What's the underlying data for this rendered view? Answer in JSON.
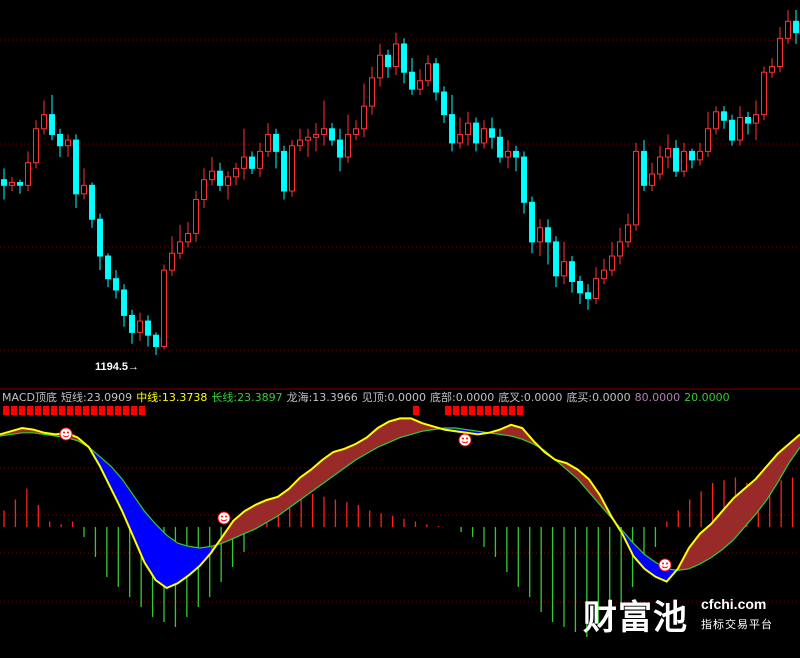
{
  "price_label": {
    "low_text": "1194.5→"
  },
  "indicator_header": {
    "title": "MACD顶底",
    "items": [
      {
        "label": "短线:23.0909",
        "color": "#c0c0c0"
      },
      {
        "label": "中线:13.3738",
        "color": "#ffff00"
      },
      {
        "label": "长线:23.3897",
        "color": "#33cc33"
      },
      {
        "label": "龙海:13.3966",
        "color": "#c0c0c0"
      },
      {
        "label": "见顶:0.0000",
        "color": "#c0c0c0"
      },
      {
        "label": "底部:0.0000",
        "color": "#c0c0c0"
      },
      {
        "label": "底叉:0.0000",
        "color": "#c0c0c0"
      },
      {
        "label": "底买:0.0000",
        "color": "#c0c0c0"
      },
      {
        "label": "80.0000",
        "color": "#b080b0"
      },
      {
        "label": "20.0000",
        "color": "#33cc33"
      }
    ]
  },
  "watermark": {
    "brand_cn": "财富池",
    "url": "cfchi.com",
    "tagline": "指标交易平台"
  },
  "colors": {
    "up": "#ff3333",
    "down": "#00ffff",
    "grid": "#800000",
    "fast_line": "#ffff00",
    "slow_line": "#33cc33",
    "bear_fill": "#0000ff",
    "bull_fill": "#992a2a",
    "signal_red": "#ff0000"
  },
  "chart_data": {
    "type": "candlestick",
    "low_annotation": 1194.5,
    "candles": [
      [
        0,
        0.62,
        0.6,
        0.55,
        0.66
      ],
      [
        1,
        0.6,
        0.61,
        0.58,
        0.63
      ],
      [
        2,
        0.61,
        0.6,
        0.57,
        0.62
      ],
      [
        3,
        0.6,
        0.68,
        0.58,
        0.72
      ],
      [
        4,
        0.68,
        0.8,
        0.66,
        0.83
      ],
      [
        5,
        0.8,
        0.85,
        0.78,
        0.9
      ],
      [
        6,
        0.85,
        0.78,
        0.76,
        0.92
      ],
      [
        7,
        0.78,
        0.74,
        0.7,
        0.8
      ],
      [
        8,
        0.74,
        0.76,
        0.7,
        0.78
      ],
      [
        9,
        0.76,
        0.57,
        0.52,
        0.78
      ],
      [
        10,
        0.57,
        0.6,
        0.55,
        0.66
      ],
      [
        11,
        0.6,
        0.48,
        0.45,
        0.61
      ],
      [
        12,
        0.48,
        0.35,
        0.3,
        0.5
      ],
      [
        13,
        0.35,
        0.27,
        0.24,
        0.36
      ],
      [
        14,
        0.27,
        0.23,
        0.2,
        0.3
      ],
      [
        15,
        0.23,
        0.14,
        0.1,
        0.25
      ],
      [
        16,
        0.14,
        0.08,
        0.04,
        0.16
      ],
      [
        17,
        0.08,
        0.12,
        0.05,
        0.15
      ],
      [
        18,
        0.12,
        0.07,
        0.03,
        0.14
      ],
      [
        19,
        0.07,
        0.03,
        0.0,
        0.08
      ],
      [
        20,
        0.03,
        0.3,
        0.02,
        0.32
      ],
      [
        21,
        0.3,
        0.36,
        0.28,
        0.42
      ],
      [
        22,
        0.36,
        0.4,
        0.34,
        0.46
      ],
      [
        23,
        0.4,
        0.43,
        0.38,
        0.47
      ],
      [
        24,
        0.43,
        0.55,
        0.4,
        0.58
      ],
      [
        25,
        0.55,
        0.62,
        0.52,
        0.66
      ],
      [
        26,
        0.62,
        0.65,
        0.6,
        0.7
      ],
      [
        27,
        0.65,
        0.6,
        0.58,
        0.68
      ],
      [
        28,
        0.6,
        0.63,
        0.55,
        0.65
      ],
      [
        29,
        0.63,
        0.66,
        0.6,
        0.68
      ],
      [
        30,
        0.66,
        0.7,
        0.62,
        0.8
      ],
      [
        31,
        0.7,
        0.66,
        0.64,
        0.72
      ],
      [
        32,
        0.66,
        0.72,
        0.63,
        0.75
      ],
      [
        33,
        0.72,
        0.78,
        0.7,
        0.82
      ],
      [
        34,
        0.78,
        0.72,
        0.66,
        0.8
      ],
      [
        35,
        0.72,
        0.58,
        0.55,
        0.74
      ],
      [
        36,
        0.58,
        0.74,
        0.56,
        0.76
      ],
      [
        37,
        0.74,
        0.76,
        0.72,
        0.8
      ],
      [
        38,
        0.76,
        0.77,
        0.7,
        0.8
      ],
      [
        39,
        0.77,
        0.78,
        0.72,
        0.82
      ],
      [
        40,
        0.78,
        0.8,
        0.74,
        0.9
      ],
      [
        41,
        0.8,
        0.76,
        0.74,
        0.82
      ],
      [
        42,
        0.76,
        0.7,
        0.65,
        0.8
      ],
      [
        43,
        0.7,
        0.78,
        0.68,
        0.85
      ],
      [
        44,
        0.78,
        0.8,
        0.76,
        0.83
      ],
      [
        45,
        0.8,
        0.88,
        0.77,
        0.96
      ],
      [
        46,
        0.88,
        0.98,
        0.85,
        1.02
      ],
      [
        47,
        0.98,
        1.06,
        0.95,
        1.1
      ],
      [
        48,
        1.06,
        1.02,
        0.98,
        1.08
      ],
      [
        49,
        1.02,
        1.1,
        0.99,
        1.14
      ],
      [
        50,
        1.1,
        1.0,
        0.96,
        1.12
      ],
      [
        51,
        1.0,
        0.94,
        0.92,
        1.05
      ],
      [
        52,
        0.94,
        0.97,
        0.92,
        1.01
      ],
      [
        53,
        0.97,
        1.03,
        0.95,
        1.06
      ],
      [
        54,
        1.03,
        0.93,
        0.9,
        1.05
      ],
      [
        55,
        0.93,
        0.85,
        0.82,
        0.95
      ],
      [
        56,
        0.85,
        0.75,
        0.72,
        0.92
      ],
      [
        57,
        0.75,
        0.78,
        0.73,
        0.84
      ],
      [
        58,
        0.78,
        0.82,
        0.74,
        0.86
      ],
      [
        59,
        0.82,
        0.75,
        0.72,
        0.84
      ],
      [
        60,
        0.75,
        0.8,
        0.73,
        0.83
      ],
      [
        61,
        0.8,
        0.77,
        0.73,
        0.84
      ],
      [
        62,
        0.77,
        0.7,
        0.68,
        0.8
      ],
      [
        63,
        0.7,
        0.72,
        0.66,
        0.76
      ],
      [
        64,
        0.72,
        0.7,
        0.65,
        0.74
      ],
      [
        65,
        0.7,
        0.54,
        0.5,
        0.72
      ],
      [
        66,
        0.54,
        0.4,
        0.36,
        0.56
      ],
      [
        67,
        0.4,
        0.45,
        0.35,
        0.48
      ],
      [
        68,
        0.45,
        0.4,
        0.32,
        0.48
      ],
      [
        69,
        0.4,
        0.28,
        0.24,
        0.42
      ],
      [
        70,
        0.28,
        0.33,
        0.25,
        0.4
      ],
      [
        71,
        0.33,
        0.26,
        0.22,
        0.35
      ],
      [
        72,
        0.26,
        0.22,
        0.18,
        0.28
      ],
      [
        73,
        0.22,
        0.2,
        0.16,
        0.25
      ],
      [
        74,
        0.2,
        0.27,
        0.18,
        0.31
      ],
      [
        75,
        0.27,
        0.3,
        0.25,
        0.34
      ],
      [
        76,
        0.3,
        0.35,
        0.28,
        0.4
      ],
      [
        77,
        0.35,
        0.4,
        0.32,
        0.45
      ],
      [
        78,
        0.4,
        0.46,
        0.38,
        0.5
      ],
      [
        79,
        0.46,
        0.72,
        0.44,
        0.75
      ],
      [
        80,
        0.72,
        0.6,
        0.58,
        0.76
      ],
      [
        81,
        0.6,
        0.64,
        0.58,
        0.68
      ],
      [
        82,
        0.64,
        0.7,
        0.62,
        0.74
      ],
      [
        83,
        0.7,
        0.73,
        0.66,
        0.78
      ],
      [
        84,
        0.73,
        0.65,
        0.63,
        0.76
      ],
      [
        85,
        0.65,
        0.72,
        0.63,
        0.75
      ],
      [
        86,
        0.72,
        0.69,
        0.66,
        0.73
      ],
      [
        87,
        0.69,
        0.72,
        0.67,
        0.75
      ],
      [
        88,
        0.72,
        0.8,
        0.7,
        0.86
      ],
      [
        89,
        0.8,
        0.86,
        0.78,
        0.88
      ],
      [
        90,
        0.86,
        0.83,
        0.8,
        0.88
      ],
      [
        91,
        0.83,
        0.76,
        0.74,
        0.85
      ],
      [
        92,
        0.76,
        0.84,
        0.74,
        0.88
      ],
      [
        93,
        0.84,
        0.82,
        0.78,
        0.86
      ],
      [
        94,
        0.82,
        0.85,
        0.76,
        0.9
      ],
      [
        95,
        0.85,
        1.0,
        0.83,
        1.02
      ],
      [
        96,
        1.0,
        1.02,
        0.98,
        1.05
      ],
      [
        97,
        1.02,
        1.12,
        1.0,
        1.16
      ],
      [
        98,
        1.12,
        1.18,
        1.1,
        1.22
      ],
      [
        99,
        1.18,
        1.14,
        1.1,
        1.22
      ]
    ],
    "indicator": {
      "fast": [
        0.96,
        0.98,
        1.0,
        0.99,
        0.97,
        0.96,
        0.97,
        0.94,
        0.88,
        0.76,
        0.62,
        0.48,
        0.32,
        0.16,
        0.05,
        0.0,
        0.03,
        0.08,
        0.14,
        0.22,
        0.32,
        0.42,
        0.48,
        0.52,
        0.55,
        0.57,
        0.62,
        0.69,
        0.74,
        0.8,
        0.85,
        0.87,
        0.9,
        0.94,
        1.0,
        1.04,
        1.06,
        1.06,
        1.03,
        1.01,
        0.99,
        0.98,
        0.97,
        0.96,
        0.97,
        0.99,
        1.02,
        1.0,
        0.92,
        0.85,
        0.8,
        0.78,
        0.74,
        0.68,
        0.58,
        0.45,
        0.34,
        0.2,
        0.12,
        0.07,
        0.04,
        0.12,
        0.25,
        0.34,
        0.4,
        0.48,
        0.56,
        0.62,
        0.68,
        0.76,
        0.84,
        0.9,
        0.96
      ],
      "slow": [
        0.95,
        0.96,
        0.97,
        0.97,
        0.96,
        0.95,
        0.94,
        0.92,
        0.88,
        0.82,
        0.76,
        0.68,
        0.58,
        0.48,
        0.4,
        0.33,
        0.28,
        0.26,
        0.25,
        0.26,
        0.28,
        0.31,
        0.34,
        0.37,
        0.41,
        0.45,
        0.5,
        0.55,
        0.6,
        0.65,
        0.7,
        0.75,
        0.8,
        0.84,
        0.88,
        0.91,
        0.94,
        0.96,
        0.98,
        0.99,
        1.0,
        1.0,
        0.99,
        0.98,
        0.97,
        0.96,
        0.95,
        0.93,
        0.9,
        0.86,
        0.8,
        0.74,
        0.68,
        0.6,
        0.52,
        0.44,
        0.36,
        0.28,
        0.21,
        0.16,
        0.12,
        0.11,
        0.12,
        0.15,
        0.19,
        0.24,
        0.3,
        0.38,
        0.46,
        0.55,
        0.66,
        0.78,
        0.88
      ],
      "histogram": [
        0.3,
        0.5,
        0.7,
        0.4,
        0.1,
        0.05,
        0.1,
        -0.1,
        -0.3,
        -0.5,
        -0.6,
        -0.7,
        -0.8,
        -0.9,
        -0.95,
        -1.0,
        -0.9,
        -0.8,
        -0.7,
        -0.55,
        -0.4,
        -0.25,
        0.1,
        0.3,
        0.45,
        0.5,
        0.55,
        0.6,
        0.55,
        0.5,
        0.45,
        0.4,
        0.3,
        0.25,
        0.2,
        0.15,
        0.1,
        0.05,
        0.02,
        0.0,
        -0.05,
        -0.1,
        -0.2,
        -0.3,
        -0.45,
        -0.6,
        -0.7,
        -0.85,
        -0.95,
        -1.0,
        -1.05,
        -1.1,
        -1.0,
        -0.9,
        -0.8,
        -0.6,
        -0.4,
        -0.2,
        0.1,
        0.3,
        0.5,
        0.65,
        0.8,
        0.85,
        0.9,
        0.8,
        0.7,
        0.75,
        0.85,
        0.9
      ]
    },
    "signal_markers_top": [
      0,
      1,
      2,
      3,
      4,
      5,
      6,
      7,
      8,
      9,
      10,
      11,
      12,
      13,
      14,
      15,
      16,
      17,
      52,
      56,
      57,
      58,
      59,
      60,
      61,
      62,
      63,
      64,
      65
    ]
  }
}
